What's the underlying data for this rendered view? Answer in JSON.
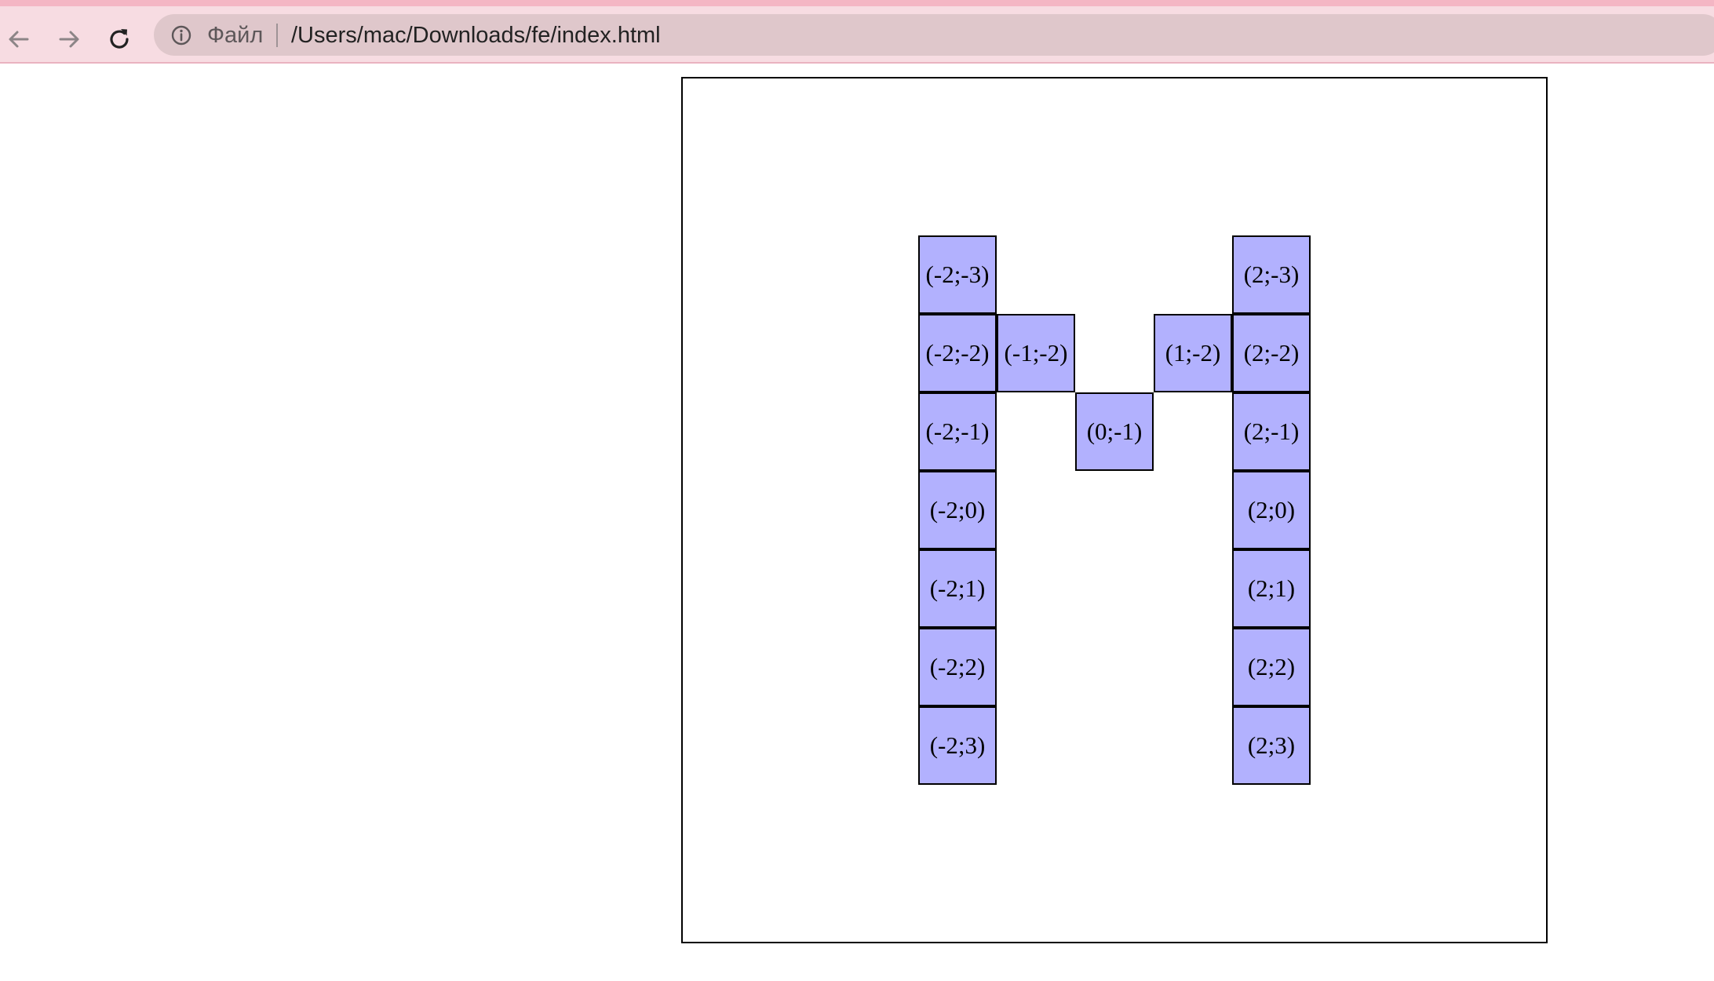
{
  "browser": {
    "nav": {
      "back_icon": "arrow-left-icon",
      "forward_icon": "arrow-right-icon",
      "reload_icon": "reload-icon"
    },
    "omnibox": {
      "info_icon": "info-icon",
      "scheme_label": "Файл",
      "url": "/Users/mac/Downloads/fe/index.html"
    },
    "colors": {
      "toolbar": "#f7dce2",
      "omnibox": "#dfc7cb",
      "cell_fill": "#b2b1fe"
    }
  },
  "grid": {
    "cells": [
      {
        "x": -2,
        "y": -3,
        "label": "(-2;-3)"
      },
      {
        "x": 2,
        "y": -3,
        "label": "(2;-3)"
      },
      {
        "x": -2,
        "y": -2,
        "label": "(-2;-2)"
      },
      {
        "x": -1,
        "y": -2,
        "label": "(-1;-2)"
      },
      {
        "x": 1,
        "y": -2,
        "label": "(1;-2)"
      },
      {
        "x": 2,
        "y": -2,
        "label": "(2;-2)"
      },
      {
        "x": -2,
        "y": -1,
        "label": "(-2;-1)"
      },
      {
        "x": 0,
        "y": -1,
        "label": "(0;-1)"
      },
      {
        "x": 2,
        "y": -1,
        "label": "(2;-1)"
      },
      {
        "x": -2,
        "y": 0,
        "label": "(-2;0)"
      },
      {
        "x": 2,
        "y": 0,
        "label": "(2;0)"
      },
      {
        "x": -2,
        "y": 1,
        "label": "(-2;1)"
      },
      {
        "x": 2,
        "y": 1,
        "label": "(2;1)"
      },
      {
        "x": -2,
        "y": 2,
        "label": "(-2;2)"
      },
      {
        "x": 2,
        "y": 2,
        "label": "(2;2)"
      },
      {
        "x": -2,
        "y": 3,
        "label": "(-2;3)"
      },
      {
        "x": 2,
        "y": 3,
        "label": "(2;3)"
      }
    ]
  }
}
